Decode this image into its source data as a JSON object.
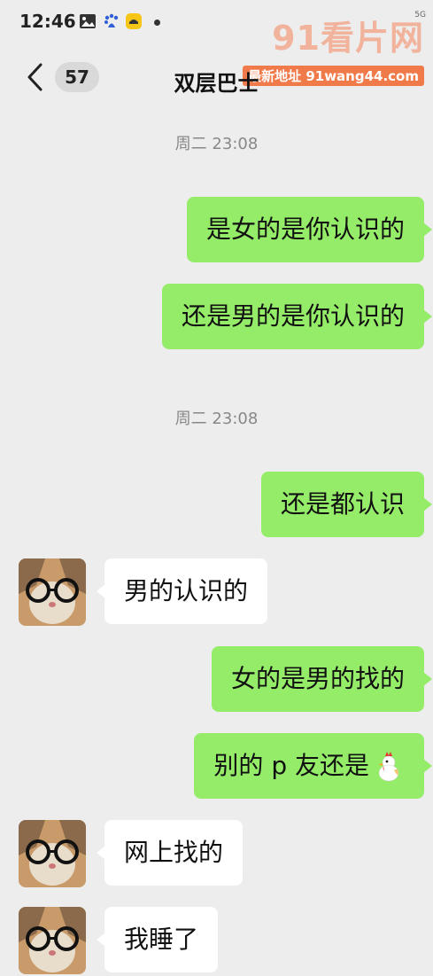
{
  "status_bar": {
    "time": "12:46",
    "icons": [
      "image-icon",
      "baidu-paw-icon",
      "yellow-app-icon"
    ],
    "network": "5G"
  },
  "watermark": {
    "logo_text": "91看片网",
    "url_text": "最新地址 91wang44.com"
  },
  "header": {
    "back_count": "57",
    "title": "双层巴士"
  },
  "timestamps": [
    "周二 23:08",
    "周二 23:08"
  ],
  "messages": [
    {
      "side": "out",
      "text": "是女的是你认识的"
    },
    {
      "side": "out",
      "text": "还是男的是你认识的"
    },
    {
      "side": "out",
      "text": "还是都认识"
    },
    {
      "side": "in",
      "text": "男的认识的"
    },
    {
      "side": "out",
      "text": "女的是男的找的"
    },
    {
      "side": "out",
      "text": "别的 p 友还是",
      "emoji": "chicken-icon"
    },
    {
      "side": "in",
      "text": "网上找的"
    },
    {
      "side": "in",
      "text": "我睡了"
    }
  ],
  "colors": {
    "background": "#ededed",
    "outgoing_bubble": "#95ec69",
    "incoming_bubble": "#ffffff",
    "timestamp_text": "#888888"
  }
}
